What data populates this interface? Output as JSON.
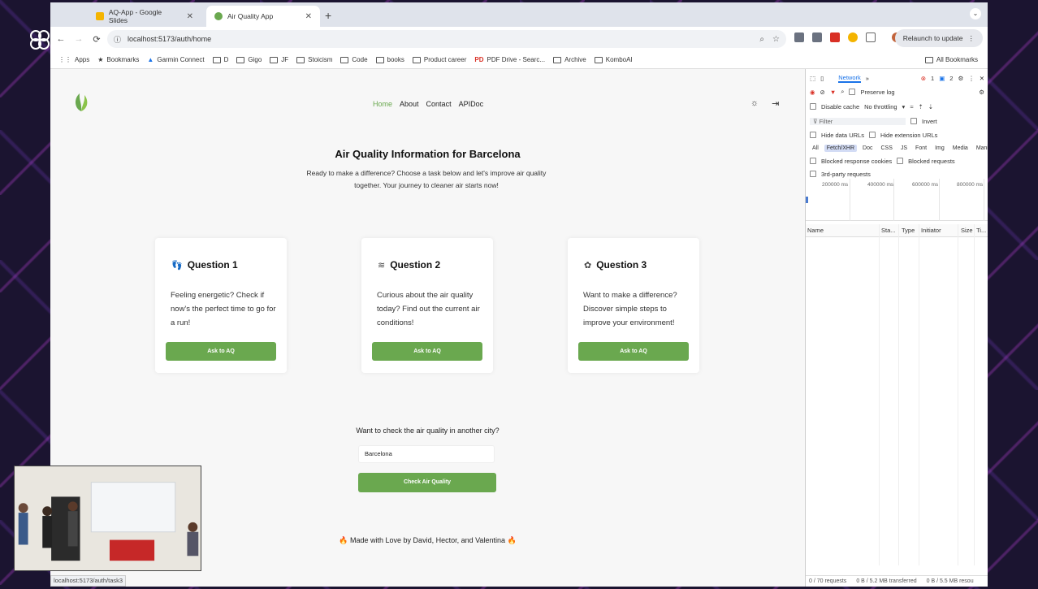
{
  "tabs": [
    {
      "label": "AQ-App - Google Slides",
      "favicon_color": "#f4b400"
    },
    {
      "label": "Air Quality App",
      "favicon_color": "#6aa84f"
    }
  ],
  "toolbar": {
    "url": "localhost:5173/auth/home",
    "relaunch_label": "Relaunch to update"
  },
  "bookmarks": {
    "items": [
      "Apps",
      "Bookmarks",
      "Garmin Connect",
      "D",
      "Gigo",
      "JF",
      "Stoicism",
      "Code",
      "books",
      "Product career",
      "PDF Drive - Searc...",
      "Archive",
      "KomboAI"
    ],
    "all_label": "All Bookmarks"
  },
  "app": {
    "nav": [
      "Home",
      "About",
      "Contact",
      "APIDoc"
    ],
    "title": "Air Quality Information for Barcelona",
    "subtitle": "Ready to make a difference? Choose a task below and let's improve air quality together. Your journey to cleaner air starts now!",
    "cards": [
      {
        "title": "Question 1",
        "icon": "footprints-icon",
        "text": "Feeling energetic? Check if now's the perfect time to go for a run!",
        "button": "Ask to AQ"
      },
      {
        "title": "Question 2",
        "icon": "wind-icon",
        "text": "Curious about the air quality today? Find out the current air conditions!",
        "button": "Ask to AQ"
      },
      {
        "title": "Question 3",
        "icon": "flower-icon",
        "text": "Want to make a difference? Discover simple steps to improve your environment!",
        "button": "Ask to AQ"
      }
    ],
    "city_question": "Want to check the air quality in another city?",
    "city_value": "Barcelona",
    "check_button": "Check Air Quality",
    "footer": "🔥 Made with Love by David, Hector, and Valentina 🔥",
    "accent": "#6aa84f"
  },
  "status_url": "localhost:5173/auth/task3",
  "devtools": {
    "panel": "Network",
    "errors": "1",
    "warnings": "2",
    "preserve_log": "Preserve log",
    "disable_cache": "Disable cache",
    "throttling": "No throttling",
    "filter_placeholder": "Filter",
    "invert": "Invert",
    "hide_data_urls": "Hide data URLs",
    "hide_extension_urls": "Hide extension URLs",
    "types": [
      "All",
      "Fetch/XHR",
      "Doc",
      "CSS",
      "JS",
      "Font",
      "Img",
      "Media",
      "Mani"
    ],
    "blocked_cookies": "Blocked response cookies",
    "blocked_requests": "Blocked requests",
    "third_party": "3rd-party requests",
    "timeline_ticks": [
      "200000 ms",
      "400000 ms",
      "600000 ms",
      "800000 ms"
    ],
    "columns": [
      "Name",
      "Sta...",
      "Type",
      "Initiator",
      "Size",
      "Ti..."
    ],
    "footer": [
      "0 / 70 requests",
      "0 B / 5.2 MB transferred",
      "0 B / 5.5 MB resou"
    ]
  }
}
